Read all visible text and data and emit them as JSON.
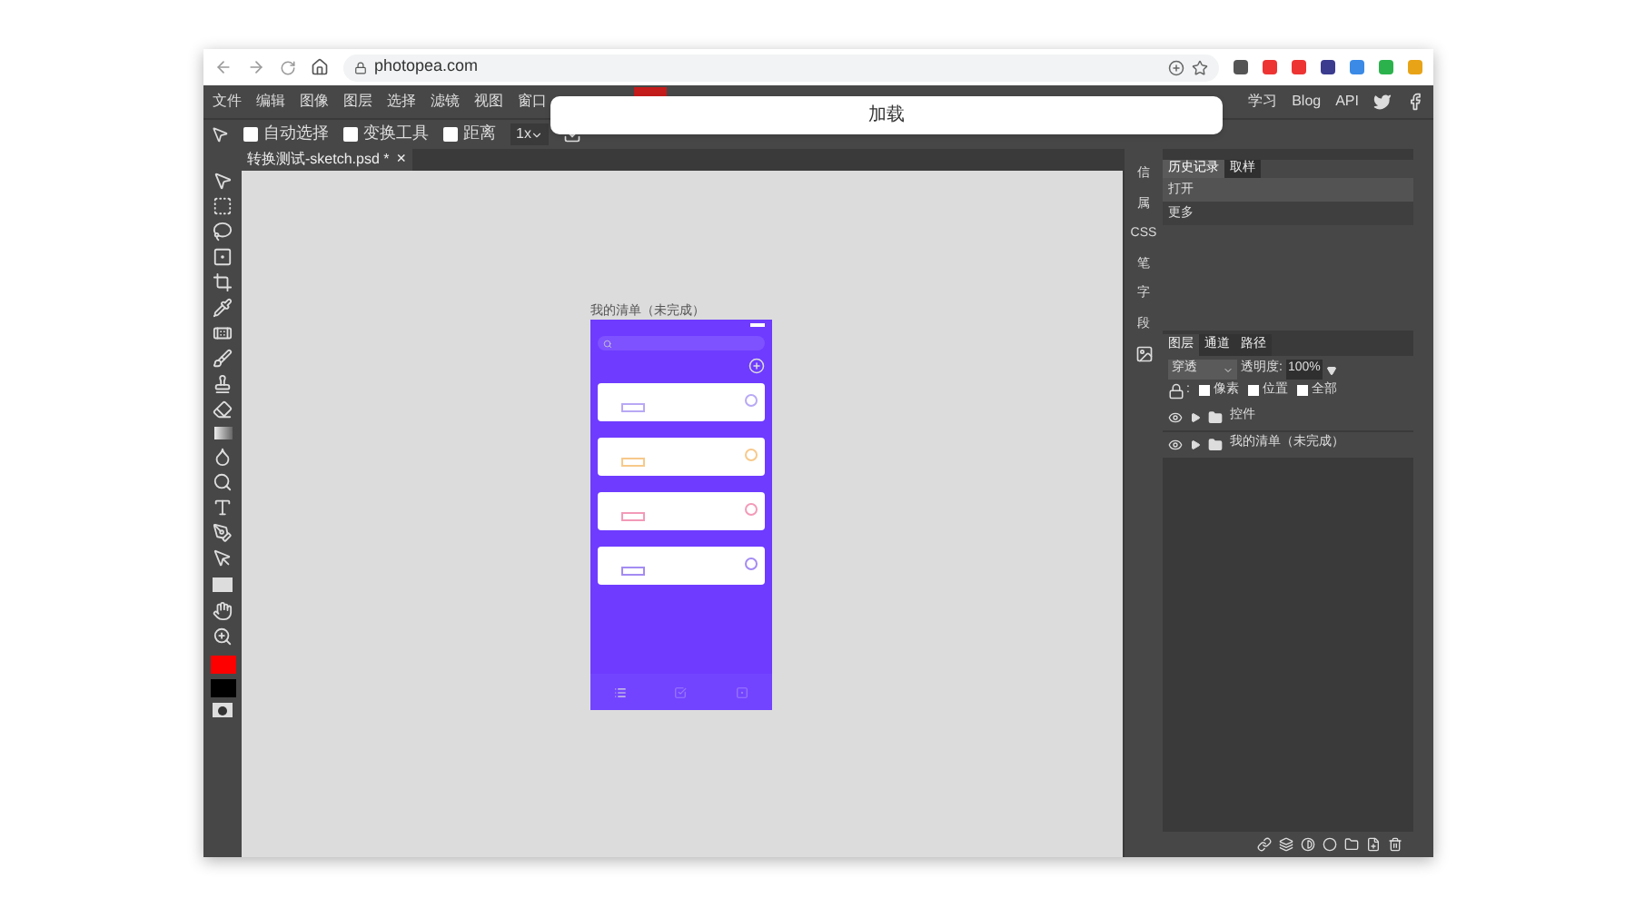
{
  "browser": {
    "url": "photopea.com"
  },
  "menu": {
    "items": [
      "文件",
      "编辑",
      "图像",
      "图层",
      "选择",
      "滤镜",
      "视图",
      "窗口"
    ],
    "right_items": [
      "学习",
      "Blog",
      "API"
    ]
  },
  "options": {
    "checkboxes": [
      {
        "label": "自动选择",
        "checked": false
      },
      {
        "label": "变换工具",
        "checked": false
      },
      {
        "label": "距离",
        "checked": false
      }
    ],
    "zoom": "1x"
  },
  "loading": {
    "title": "加载"
  },
  "document_tabs": [
    {
      "label": "转换测试-sketch.psd *",
      "selected": true,
      "close": "×"
    }
  ],
  "artboard": {
    "title": "我的清单（未完成）",
    "cards": [
      {
        "color": "#b9a8f5"
      },
      {
        "color": "#f7c98a"
      },
      {
        "color": "#f39ab8"
      },
      {
        "color": "#a48bf3"
      }
    ]
  },
  "side_strip": [
    "信",
    "属",
    "CSS",
    "笔",
    "字",
    "段"
  ],
  "history_panel": {
    "tabs": [
      {
        "label": "历史记录",
        "selected": true
      },
      {
        "label": "取样",
        "selected": false
      }
    ],
    "items": [
      "打开",
      "更多"
    ]
  },
  "layers_panel": {
    "tabs": [
      {
        "label": "图层",
        "selected": true
      },
      {
        "label": "通道",
        "selected": false
      },
      {
        "label": "路径",
        "selected": false
      }
    ],
    "blend_mode": "穿透",
    "opacity_label": "透明度:",
    "opacity": "100%",
    "lock_label": ":",
    "locks": [
      {
        "label": "像素",
        "checked": false
      },
      {
        "label": "位置",
        "checked": false
      },
      {
        "label": "全部",
        "checked": false
      }
    ],
    "layers": [
      {
        "name": "控件",
        "visible": true
      },
      {
        "name": "我的清单（未完成）",
        "visible": true
      }
    ]
  }
}
